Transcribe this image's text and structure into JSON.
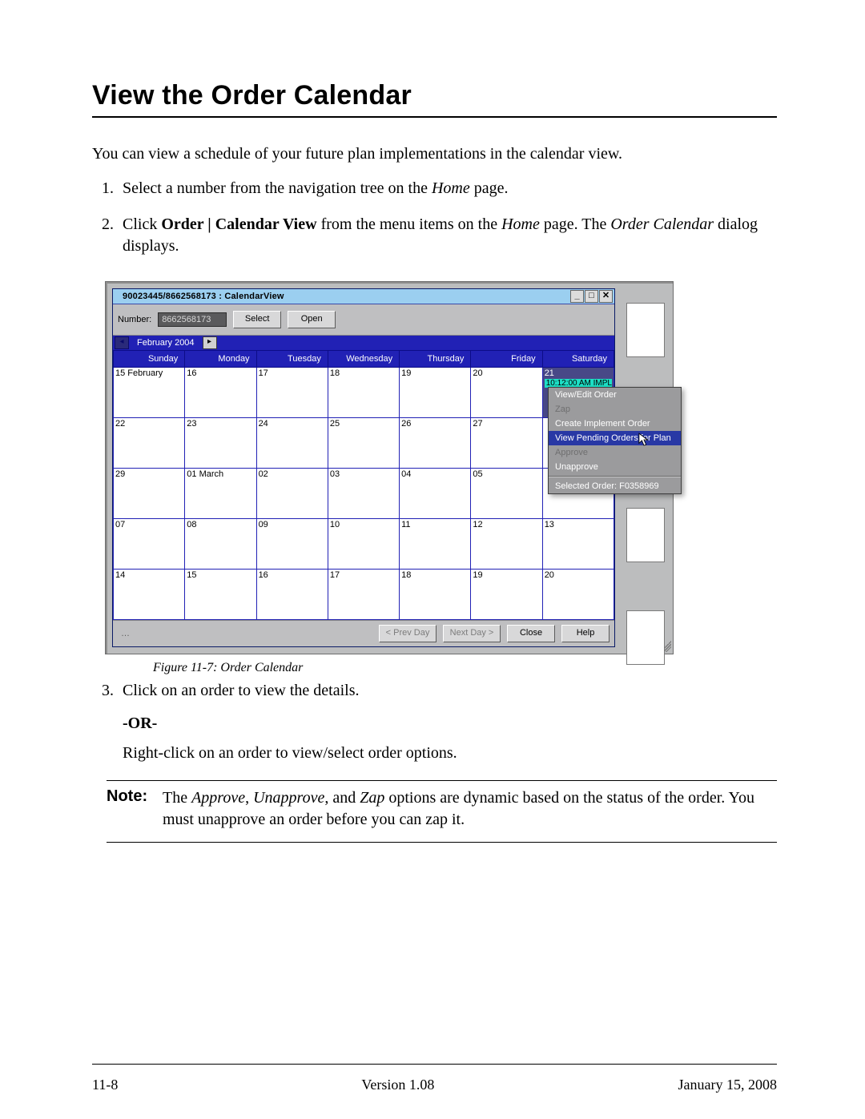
{
  "page": {
    "title": "View the Order Calendar",
    "intro": "You can view a schedule of your future plan implementations in the calendar view.",
    "step1": "Select a number from the navigation tree on the ",
    "step1_i1": "Home",
    "step1_tail": " page.",
    "step2_a": "Click ",
    "step2_b": "Order | Calendar View",
    "step2_c": " from the menu items on the ",
    "step2_i1": "Home",
    "step2_d": " page. The ",
    "step2_i2": "Order Calendar",
    "step2_e": " dialog displays.",
    "figure_caption": "Figure 11-7:   Order Calendar",
    "step3": "Click on an order to view the details.",
    "or_label": "-OR-",
    "right_click_text": "Right-click on an order to view/select order options.",
    "note_label": "Note:",
    "note_a": "The ",
    "note_i1": "Approve",
    "note_b": ", ",
    "note_i2": "Unapprove",
    "note_c": ", and ",
    "note_i3": "Zap",
    "note_d": " options are dynamic based on the status of the order. You must unapprove an order before you can zap it."
  },
  "dialog": {
    "title": "90023445/8662568173 : CalendarView",
    "number_label": "Number:",
    "number_value": "8662568173",
    "btn_select": "Select",
    "btn_open": "Open",
    "month_label": "February 2004",
    "days": [
      "Sunday",
      "Monday",
      "Tuesday",
      "Wednesday",
      "Thursday",
      "Friday",
      "Saturday"
    ],
    "cells": [
      [
        "15 February",
        "16",
        "17",
        "18",
        "19",
        "20",
        "21"
      ],
      [
        "22",
        "23",
        "24",
        "25",
        "26",
        "27",
        ""
      ],
      [
        "29",
        "01 March",
        "02",
        "03",
        "04",
        "05",
        ""
      ],
      [
        "07",
        "08",
        "09",
        "10",
        "11",
        "12",
        "13"
      ],
      [
        "14",
        "15",
        "16",
        "17",
        "18",
        "19",
        "20"
      ]
    ],
    "event_label": "10:12:00 AM IMPL",
    "status_text": "…",
    "btn_prev": "< Prev Day",
    "btn_next": "Next Day >",
    "btn_close": "Close",
    "btn_help": "Help"
  },
  "context_menu": {
    "items": {
      "view_edit": "View/Edit Order",
      "zap": "Zap",
      "create_impl": "Create Implement Order",
      "view_pending": "View Pending Orders for Plan",
      "approve": "Approve",
      "unapprove": "Unapprove",
      "selected_order": "Selected Order: F0358969"
    }
  },
  "footer": {
    "left": "11-8",
    "center": "Version 1.08",
    "right": "January 15, 2008"
  }
}
